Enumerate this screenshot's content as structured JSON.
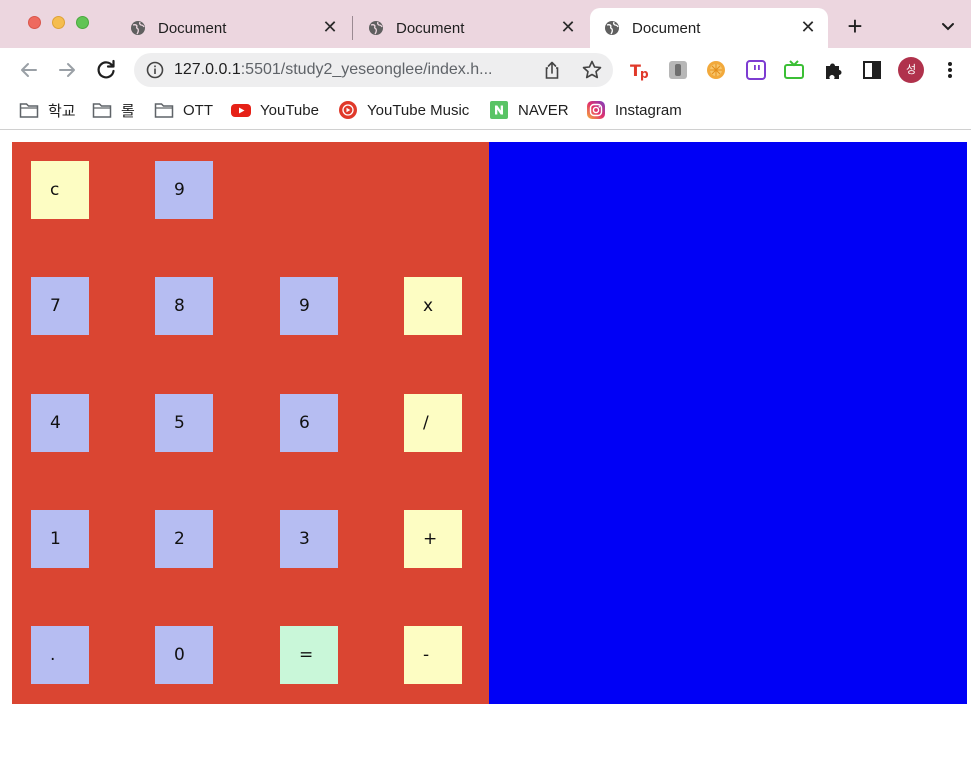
{
  "tabs": [
    {
      "title": "Document",
      "close": "✕"
    },
    {
      "title": "Document",
      "close": "✕"
    },
    {
      "title": "Document",
      "close": "✕"
    }
  ],
  "new_tab": "+",
  "toolbar": {
    "url_host": "127.0.0.1",
    "url_path": ":5501/study2_yeseonglee/index.h...",
    "avatar_label": "성"
  },
  "bookmarks": [
    {
      "label": "학교",
      "icon": "folder-icon"
    },
    {
      "label": "롤",
      "icon": "folder-icon"
    },
    {
      "label": "OTT",
      "icon": "folder-icon"
    },
    {
      "label": "YouTube",
      "icon": "youtube-icon"
    },
    {
      "label": "YouTube Music",
      "icon": "youtube-music-icon"
    },
    {
      "label": "NAVER",
      "icon": "naver-icon"
    },
    {
      "label": "Instagram",
      "icon": "instagram-icon"
    }
  ],
  "calculator": {
    "keys": [
      {
        "label": "c",
        "kind": "op"
      },
      {
        "label": "9",
        "kind": "num"
      },
      {
        "label": "7",
        "kind": "num"
      },
      {
        "label": "8",
        "kind": "num"
      },
      {
        "label": "9",
        "kind": "num"
      },
      {
        "label": "x",
        "kind": "op"
      },
      {
        "label": "4",
        "kind": "num"
      },
      {
        "label": "5",
        "kind": "num"
      },
      {
        "label": "6",
        "kind": "num"
      },
      {
        "label": "/",
        "kind": "op"
      },
      {
        "label": "1",
        "kind": "num"
      },
      {
        "label": "2",
        "kind": "num"
      },
      {
        "label": "3",
        "kind": "num"
      },
      {
        "label": "+",
        "kind": "op"
      },
      {
        "label": ".",
        "kind": "num"
      },
      {
        "label": "0",
        "kind": "num"
      },
      {
        "label": "=",
        "kind": "eq"
      },
      {
        "label": "-",
        "kind": "op"
      }
    ]
  },
  "colors": {
    "tabstrip": "#ecd6df",
    "calculator_bg": "#da4532",
    "display_bg": "#0000f6",
    "number_key": "#b6bdf2",
    "operator_key": "#fdfdc3",
    "equals_key": "#c9f7d9"
  }
}
